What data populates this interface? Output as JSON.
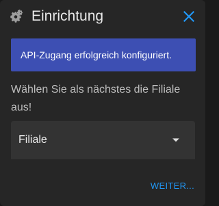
{
  "dialog": {
    "title": "Einrichtung",
    "icons": {
      "header": "gear-icon",
      "close": "close-icon",
      "select": "chevron-down-icon"
    },
    "colors": {
      "accent": "#2196f3",
      "banner_background": "#3d4fb3",
      "panel_background": "#262626"
    },
    "banner": {
      "message": "API-Zugang erfolgreich konfiguriert."
    },
    "instruction": "Wählen Sie als nächstes die Filiale aus!",
    "select": {
      "value": "Filiale"
    },
    "actions": {
      "next_label": "WEITER..."
    }
  }
}
